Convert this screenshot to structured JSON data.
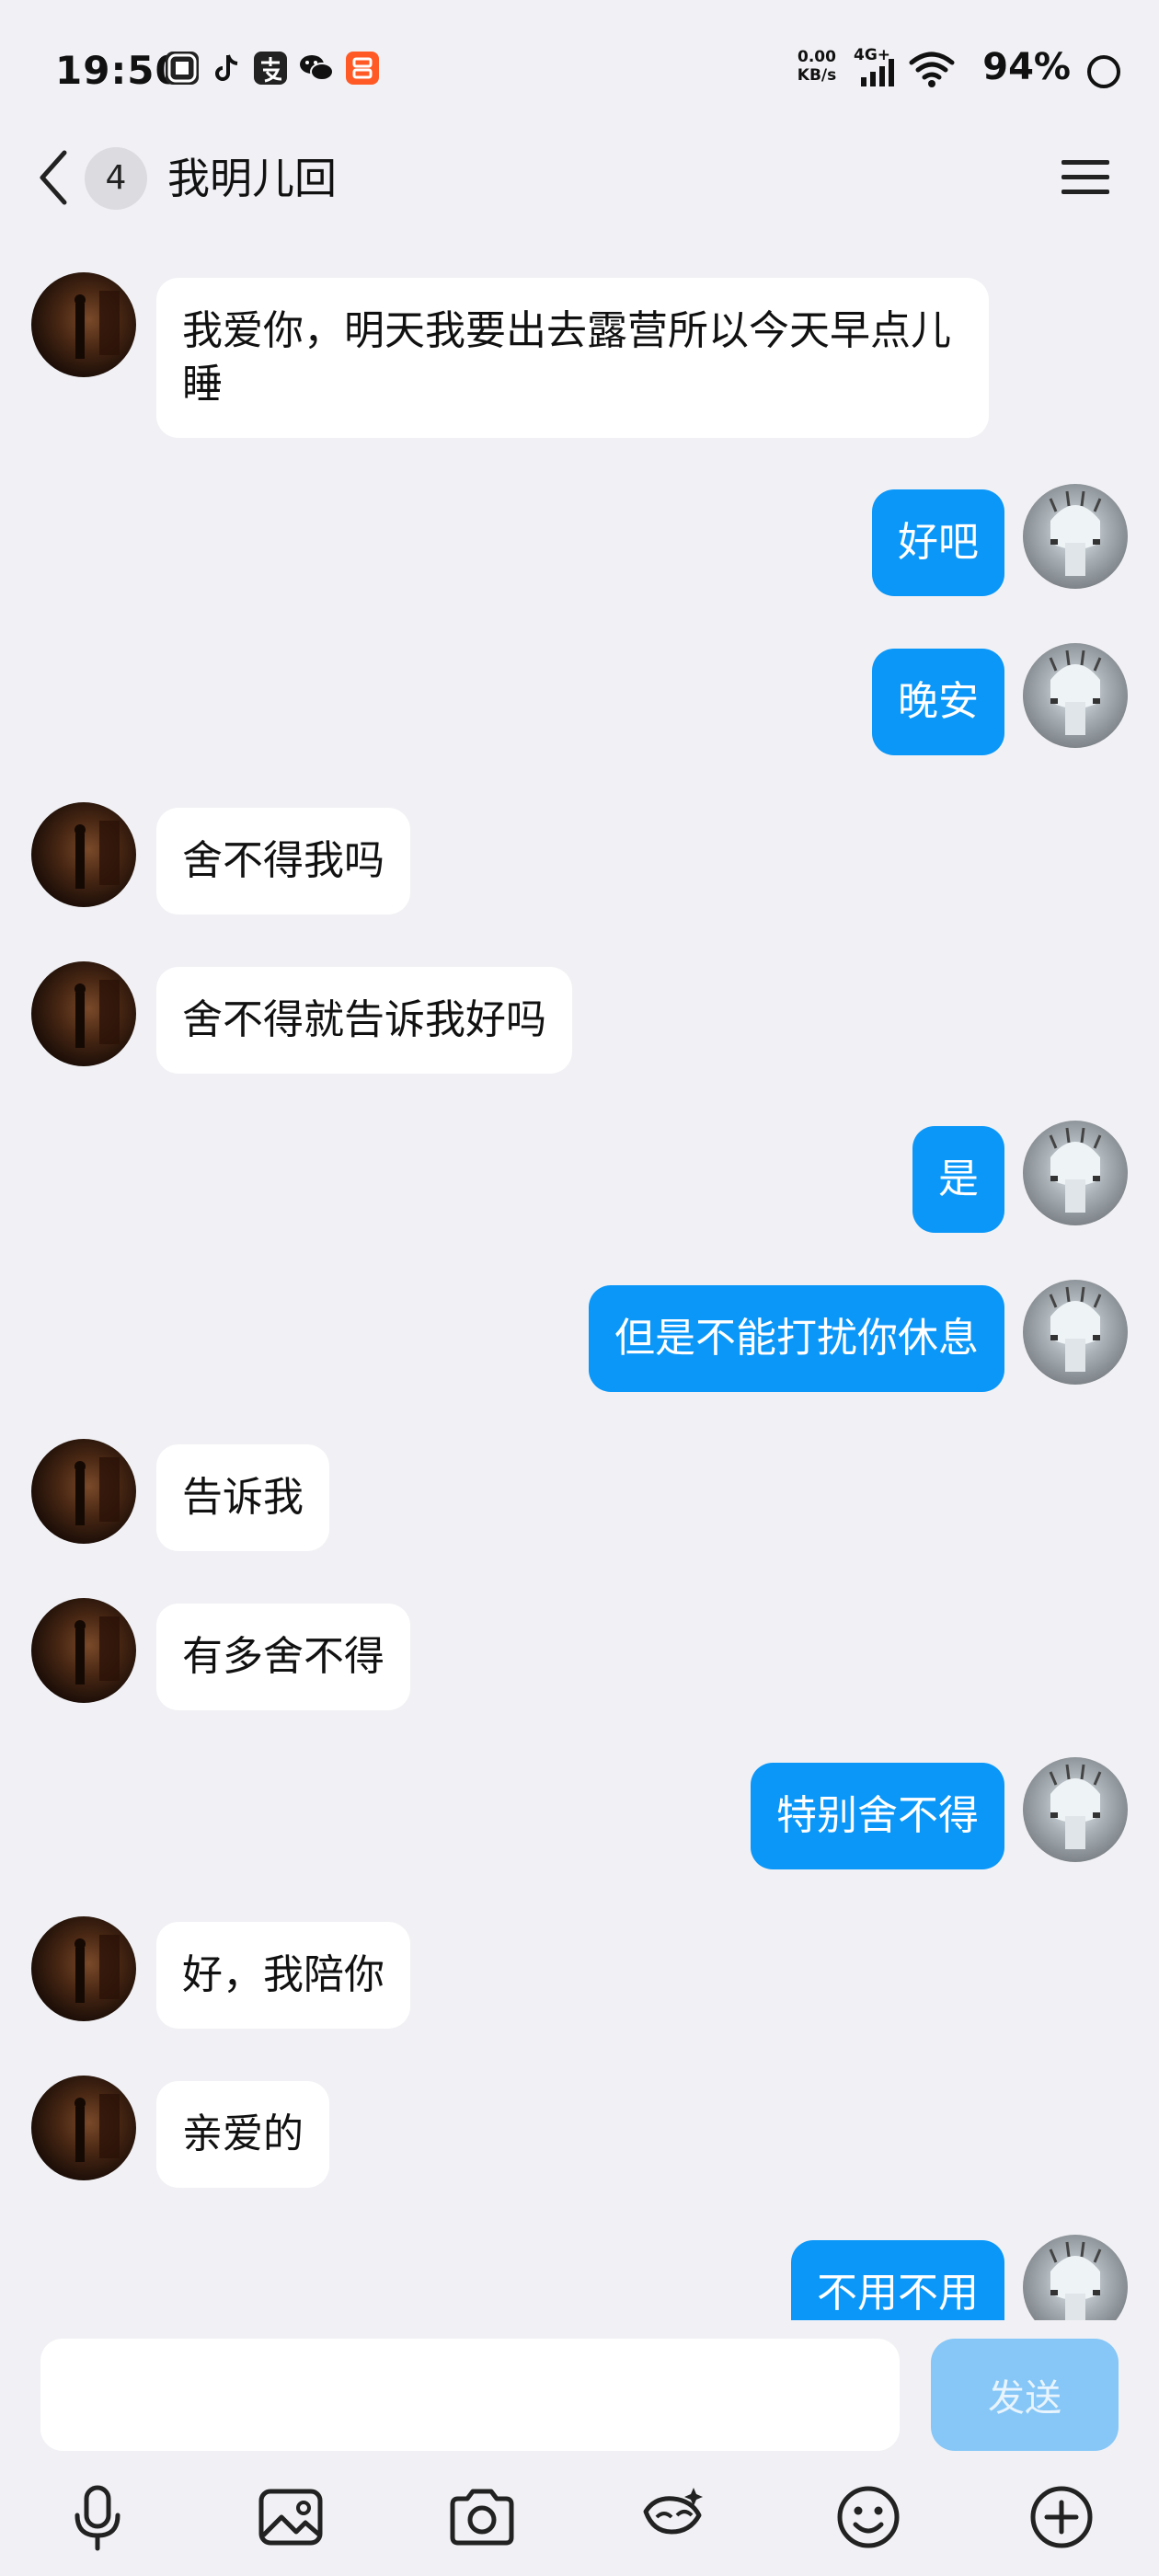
{
  "status_bar": {
    "time": "19:50",
    "net_speed_value": "0.00",
    "net_speed_unit": "KB/s",
    "network_label": "4G+",
    "battery": "94%"
  },
  "header": {
    "unread_count": "4",
    "title": "我明儿回"
  },
  "messages": [
    {
      "side": "left",
      "text": "我爱你，明天我要出去露营所以今天早点儿睡"
    },
    {
      "side": "right",
      "text": "好吧"
    },
    {
      "side": "right",
      "text": "晚安"
    },
    {
      "side": "left",
      "text": "舍不得我吗"
    },
    {
      "side": "left",
      "text": "舍不得就告诉我好吗"
    },
    {
      "side": "right",
      "text": "是"
    },
    {
      "side": "right",
      "text": "但是不能打扰你休息"
    },
    {
      "side": "left",
      "text": "告诉我"
    },
    {
      "side": "left",
      "text": "有多舍不得"
    },
    {
      "side": "right",
      "text": "特别舍不得"
    },
    {
      "side": "left",
      "text": "好，我陪你"
    },
    {
      "side": "left",
      "text": "亲爱的"
    },
    {
      "side": "right",
      "text": "不用不用"
    }
  ],
  "composer": {
    "input_value": "",
    "send_label": "发送"
  },
  "toolbar": {
    "icons": [
      "microphone-icon",
      "image-icon",
      "camera-icon",
      "theme-icon",
      "emoji-icon",
      "add-icon"
    ]
  }
}
